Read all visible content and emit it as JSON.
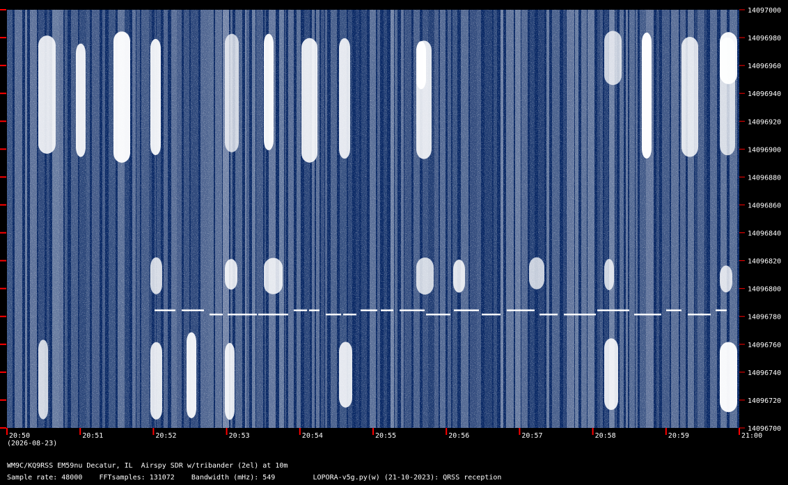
{
  "chart_data": {
    "type": "heatmap",
    "title": "",
    "xlabel": "",
    "ylabel": "",
    "x_ticks": [
      "20:50",
      "20:51",
      "20:52",
      "20:53",
      "20:54",
      "20:55",
      "20:56",
      "20:57",
      "20:58",
      "20:59",
      "21:00"
    ],
    "y_ticks": [
      14097000,
      14096980,
      14096960,
      14096940,
      14096920,
      14096900,
      14096880,
      14096860,
      14096840,
      14096820,
      14096800,
      14096780,
      14096760,
      14096740,
      14096720,
      14096700
    ],
    "xlim": [
      "20:50",
      "21:00"
    ],
    "ylim": [
      14096700,
      14097000
    ],
    "date": "(2026-08-23)",
    "colors": {
      "background": "#0b2a66",
      "signal": "#ffffff",
      "tick_marker": "#ff0000"
    },
    "trace_frequency_hz": 14096782
  },
  "footer": {
    "line1": "WM9C/KQ9RSS EM59nu Decatur, IL  Airspy SDR w/tribander (2el) at 10m",
    "line2": "Sample rate: 48000    FFTsamples: 131072    Bandwidth (mHz): 549         LOPORA-v5g.py(w) (21-10-2023): QRSS reception"
  }
}
